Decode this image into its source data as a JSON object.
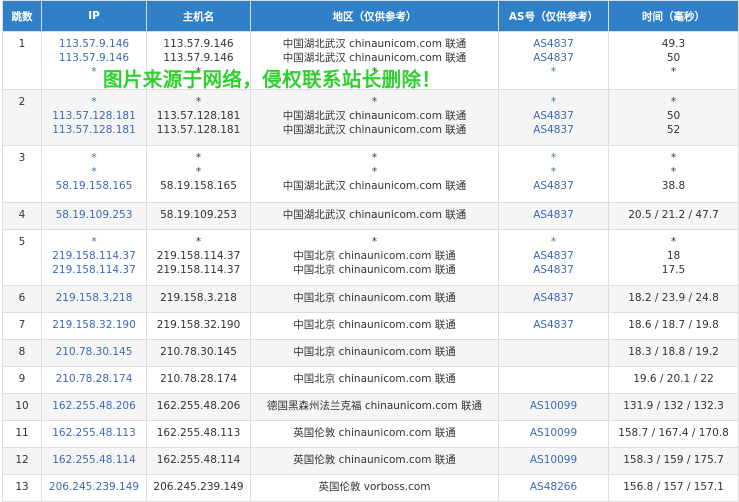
{
  "headers": [
    "跳数",
    "IP",
    "主机名",
    "地区（仅供参考）",
    "AS号（仅供参考）",
    "时间（毫秒）"
  ],
  "watermark": "图片来源于网络，侵权联系站长删除！",
  "rows": [
    {
      "hop": "1",
      "ip": [
        "113.57.9.146",
        "113.57.9.146",
        "*"
      ],
      "host": [
        "113.57.9.146",
        "113.57.9.146",
        "*"
      ],
      "region": [
        "中国湖北武汉 chinaunicom.com 联通",
        "中国湖北武汉 chinaunicom.com 联通",
        "*"
      ],
      "as": [
        "AS4837",
        "AS4837",
        "*"
      ],
      "time": [
        "49.3",
        "50",
        "*"
      ]
    },
    {
      "hop": "2",
      "ip": [
        "*",
        "113.57.128.181",
        "113.57.128.181"
      ],
      "host": [
        "*",
        "113.57.128.181",
        "113.57.128.181"
      ],
      "region": [
        "*",
        "中国湖北武汉 chinaunicom.com 联通",
        "中国湖北武汉 chinaunicom.com 联通"
      ],
      "as": [
        "*",
        "AS4837",
        "AS4837"
      ],
      "time": [
        "*",
        "50",
        "52"
      ]
    },
    {
      "hop": "3",
      "ip": [
        "*",
        "*",
        "58.19.158.165"
      ],
      "host": [
        "*",
        "*",
        "58.19.158.165"
      ],
      "region": [
        "*",
        "*",
        "中国湖北武汉 chinaunicom.com 联通"
      ],
      "as": [
        "*",
        "*",
        "AS4837"
      ],
      "time": [
        "*",
        "*",
        "38.8"
      ]
    },
    {
      "hop": "4",
      "ip": [
        "58.19.109.253"
      ],
      "host": [
        "58.19.109.253"
      ],
      "region": [
        "中国湖北武汉 chinaunicom.com 联通"
      ],
      "as": [
        "AS4837"
      ],
      "time": [
        "20.5 / 21.2 / 47.7"
      ]
    },
    {
      "hop": "5",
      "ip": [
        "*",
        "219.158.114.37",
        "219.158.114.37"
      ],
      "host": [
        "*",
        "219.158.114.37",
        "219.158.114.37"
      ],
      "region": [
        "*",
        "中国北京 chinaunicom.com 联通",
        "中国北京 chinaunicom.com 联通"
      ],
      "as": [
        "*",
        "AS4837",
        "AS4837"
      ],
      "time": [
        "*",
        "18",
        "17.5"
      ]
    },
    {
      "hop": "6",
      "ip": [
        "219.158.3.218"
      ],
      "host": [
        "219.158.3.218"
      ],
      "region": [
        "中国北京 chinaunicom.com 联通"
      ],
      "as": [
        "AS4837"
      ],
      "time": [
        "18.2 / 23.9 / 24.8"
      ]
    },
    {
      "hop": "7",
      "ip": [
        "219.158.32.190"
      ],
      "host": [
        "219.158.32.190"
      ],
      "region": [
        "中国北京 chinaunicom.com 联通"
      ],
      "as": [
        "AS4837"
      ],
      "time": [
        "18.6 / 18.7 / 19.8"
      ]
    },
    {
      "hop": "8",
      "ip": [
        "210.78.30.145"
      ],
      "host": [
        "210.78.30.145"
      ],
      "region": [
        "中国北京 chinaunicom.com 联通"
      ],
      "as": [
        ""
      ],
      "time": [
        "18.3 / 18.8 / 19.2"
      ]
    },
    {
      "hop": "9",
      "ip": [
        "210.78.28.174"
      ],
      "host": [
        "210.78.28.174"
      ],
      "region": [
        "中国北京 chinaunicom.com 联通"
      ],
      "as": [
        ""
      ],
      "time": [
        "19.6 / 20.1 / 22"
      ]
    },
    {
      "hop": "10",
      "ip": [
        "162.255.48.206"
      ],
      "host": [
        "162.255.48.206"
      ],
      "region": [
        "德国黑森州法兰克福 chinaunicom.com 联通"
      ],
      "as": [
        "AS10099"
      ],
      "time": [
        "131.9 / 132 / 132.3"
      ]
    },
    {
      "hop": "11",
      "ip": [
        "162.255.48.113"
      ],
      "host": [
        "162.255.48.113"
      ],
      "region": [
        "英国伦敦 chinaunicom.com 联通"
      ],
      "as": [
        "AS10099"
      ],
      "time": [
        "158.7 / 167.4 / 170.8"
      ]
    },
    {
      "hop": "12",
      "ip": [
        "162.255.48.114"
      ],
      "host": [
        "162.255.48.114"
      ],
      "region": [
        "英国伦敦 chinaunicom.com 联通"
      ],
      "as": [
        "AS10099"
      ],
      "time": [
        "158.3 / 159 / 175.7"
      ]
    },
    {
      "hop": "13",
      "ip": [
        "206.245.239.149"
      ],
      "host": [
        "206.245.239.149"
      ],
      "region": [
        "英国伦敦 vorboss.com"
      ],
      "as": [
        "AS48266"
      ],
      "time": [
        "156.8 / 157 / 157.1"
      ]
    }
  ]
}
